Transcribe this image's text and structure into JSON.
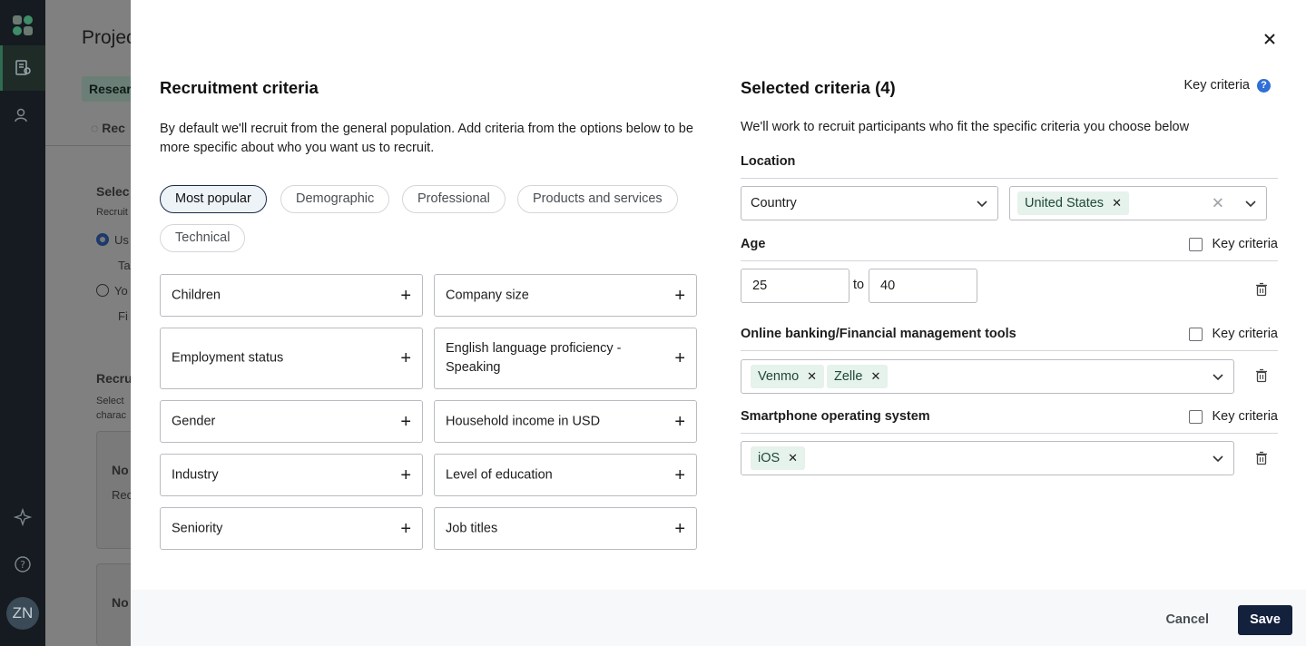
{
  "app_sidebar": {
    "avatar_initials": "ZN"
  },
  "background_page": {
    "title": "Projec",
    "tab": "Resear",
    "subtab": "Rec",
    "select_heading": "Selec",
    "recruit_text": "Recruit",
    "radio1_label": "Us",
    "radio1_sub": "Ta",
    "radio2_label": "Yo",
    "radio2_sub": "Fi",
    "section_heading": "Recru",
    "section_text_1": "Select",
    "section_text_2": "charac",
    "card1_title": "No",
    "card1_text": "Rec",
    "card2_title": "No"
  },
  "modal": {
    "left": {
      "title": "Recruitment criteria",
      "description": "By default we'll recruit from the general population. Add criteria from the options below to be more specific about who you want us to recruit.",
      "filters": [
        {
          "label": "Most popular",
          "active": true
        },
        {
          "label": "Demographic",
          "active": false
        },
        {
          "label": "Professional",
          "active": false
        },
        {
          "label": "Products and services",
          "active": false
        },
        {
          "label": "Technical",
          "active": false
        }
      ],
      "criteria": [
        {
          "label": "Children"
        },
        {
          "label": "Company size"
        },
        {
          "label": "Employment status"
        },
        {
          "label": "English language proficiency - Speaking"
        },
        {
          "label": "Gender"
        },
        {
          "label": "Household income in USD"
        },
        {
          "label": "Industry"
        },
        {
          "label": "Level of education"
        },
        {
          "label": "Seniority"
        },
        {
          "label": "Job titles"
        }
      ]
    },
    "right": {
      "title": "Selected criteria (4)",
      "key_criteria_label": "Key criteria",
      "help_icon": "?",
      "description": "We'll work to recruit participants who fit the specific criteria you choose below",
      "location": {
        "label": "Location",
        "type_value": "Country",
        "selected": [
          "United States"
        ]
      },
      "age": {
        "label": "Age",
        "key_label": "Key criteria",
        "min": "25",
        "to_label": "to",
        "max": "40"
      },
      "banking": {
        "label": "Online banking/Financial management tools",
        "key_label": "Key criteria",
        "selected": [
          "Venmo",
          "Zelle"
        ]
      },
      "smartphone": {
        "label": "Smartphone operating system",
        "key_label": "Key criteria",
        "selected": [
          "iOS"
        ]
      }
    },
    "footer": {
      "cancel_label": "Cancel",
      "save_label": "Save"
    }
  }
}
